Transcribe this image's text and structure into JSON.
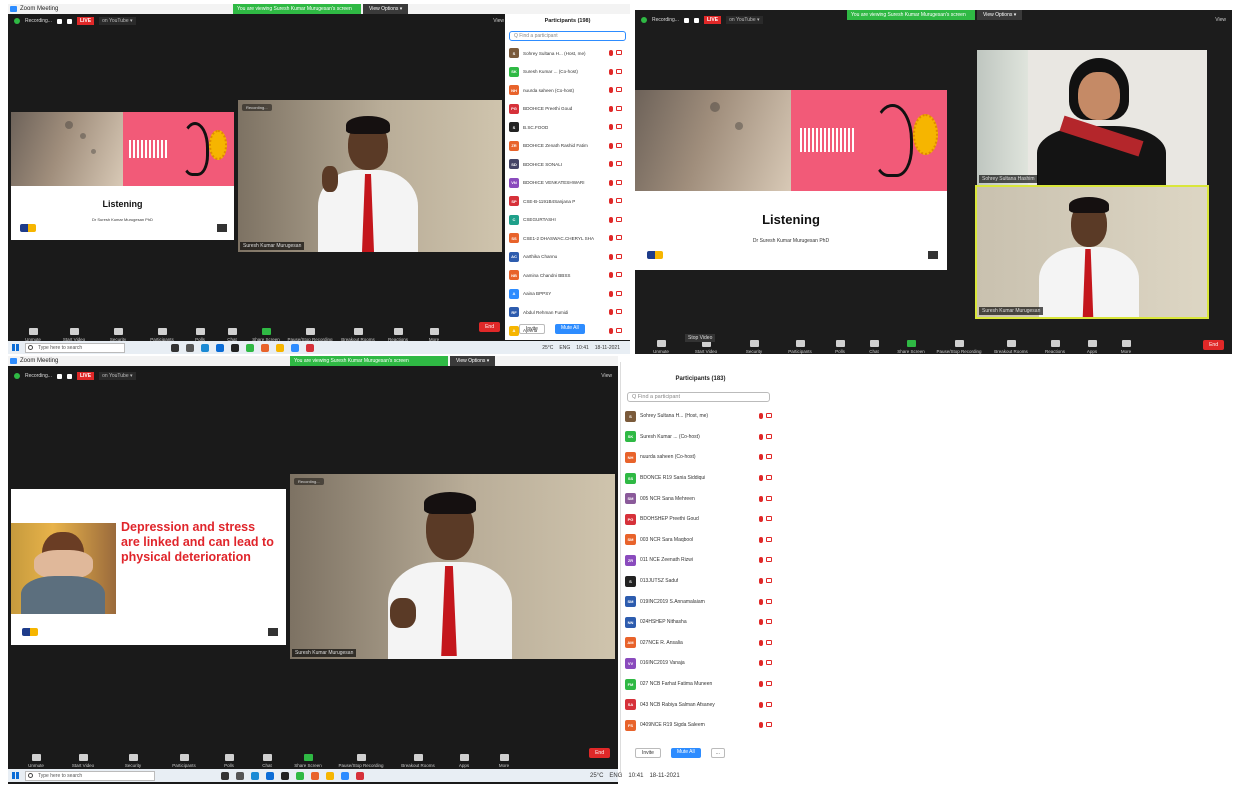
{
  "app": {
    "title": "Zoom Meeting"
  },
  "banner": {
    "sharing": "You are viewing Suresh Kumar Murugesan's screen",
    "view_options": "View Options ▾"
  },
  "topbar": {
    "recording": "Recording...",
    "live": "LIVE",
    "on_youtube": "on YouTube ▾",
    "view": "View"
  },
  "slide1": {
    "title": "Listening",
    "subtitle": "Dr Suresh Kumar Murugesan PhD"
  },
  "slide2": {
    "text": "Depression and stress are linked and can lead to physical deterioration"
  },
  "speaker": {
    "name": "Suresh Kumar Murugesan",
    "recording_badge": "Recording..."
  },
  "host_tile": {
    "name": "Sohrey Sultana Hashim"
  },
  "toolbar": {
    "items": [
      "Unmute",
      "Start Video",
      "Security",
      "Participants",
      "Polls",
      "Chat",
      "Share Screen",
      "Pause/Stop Recording",
      "Breakout Rooms",
      "Reactions",
      "Apps",
      "More"
    ],
    "participants_count": "198",
    "end": "End",
    "tooltip": "Stop Video"
  },
  "taskbar": {
    "search_placeholder": "Type here to search",
    "weather": "25°C",
    "lang": "ENG",
    "time": "10:41",
    "date": "18-11-2021"
  },
  "panel_top": {
    "header": "Participants (198)",
    "search": "Q Find a participant",
    "rows": [
      {
        "initials": "S",
        "name": "Sohrey Sultana H... (Host, me)",
        "color": "#7a5a3a"
      },
      {
        "initials": "SK",
        "name": "Suresh Kumar ... (Co-host)",
        "color": "#2fb944"
      },
      {
        "initials": "NH",
        "name": "nuurda saheen (Co-host)",
        "color": "#e8632b"
      },
      {
        "initials": "PG",
        "name": "BDOHICE Preethi Goud",
        "color": "#d6313a"
      },
      {
        "initials": "S",
        "name": "B.SC.FOOD",
        "color": "#222222"
      },
      {
        "initials": "ZR",
        "name": "BDOHICE Zenath Rashid Fatim",
        "color": "#e8632b"
      },
      {
        "initials": "SD",
        "name": "BDOHICE SONALI",
        "color": "#444466"
      },
      {
        "initials": "VN",
        "name": "BDOHICE VENKATESHWARI",
        "color": "#8a4bbd"
      },
      {
        "initials": "SP",
        "name": "CSE-B-1191B4Sanjana P",
        "color": "#d6313a"
      },
      {
        "initials": "C",
        "name": "CSEGURTASHI",
        "color": "#1fa08a"
      },
      {
        "initials": "SS",
        "name": "CSE1-2 DHASWAC.CHERYL SHA",
        "color": "#e8632b"
      },
      {
        "initials": "AC",
        "name": "Aarthika Channu",
        "color": "#2d5cae"
      },
      {
        "initials": "NB",
        "name": "Aamina Chandni BBSS",
        "color": "#e8632b"
      },
      {
        "initials": "A",
        "name": "Aaina BPPSY",
        "color": "#2d8cff"
      },
      {
        "initials": "RF",
        "name": "Abdul Rehman Fumidi",
        "color": "#2d5cae"
      },
      {
        "initials": "A",
        "name": "Ajeena",
        "color": "#f6b500"
      }
    ],
    "invite": "Invite",
    "mute_all": "Mute All"
  },
  "panel_bottom": {
    "header": "Participants (183)",
    "search": "Q Find a participant",
    "rows": [
      {
        "initials": "S",
        "name": "Sohrey Sultana H... (Host, me)",
        "color": "#7a5a3a"
      },
      {
        "initials": "SK",
        "name": "Suresh Kumar ... (Co-host)",
        "color": "#2fb944"
      },
      {
        "initials": "NH",
        "name": "nuurda saheen (Co-host)",
        "color": "#e8632b"
      },
      {
        "initials": "SS",
        "name": "BDONCE R19 Sania Siddiqui",
        "color": "#2fb944"
      },
      {
        "initials": "SM",
        "name": "005 NCR Sana Mehreen",
        "color": "#8a5a9a"
      },
      {
        "initials": "PG",
        "name": "BDOHSHEP Preethi Goud",
        "color": "#d6313a"
      },
      {
        "initials": "SM",
        "name": "003 NCR Sara Maqbool",
        "color": "#e8632b"
      },
      {
        "initials": "ZR",
        "name": "011 NCE Zeenath Rizwi",
        "color": "#8a4bbd"
      },
      {
        "initials": "S",
        "name": "013JUTSZ Saduf",
        "color": "#222222"
      },
      {
        "initials": "SM",
        "name": "019INC2019 S.Annamalaiam",
        "color": "#2d5cae"
      },
      {
        "initials": "NN",
        "name": "024HSHEP Nithasha",
        "color": "#2d5cae"
      },
      {
        "initials": "AM",
        "name": "027NCE R. Ansalia",
        "color": "#e8632b"
      },
      {
        "initials": "VV",
        "name": "016INC2019 Vanaja",
        "color": "#8a4bbd"
      },
      {
        "initials": "FM",
        "name": "027 NCB Farhat Fatima Muneen",
        "color": "#2fb944"
      },
      {
        "initials": "SA",
        "name": "043 NCB Rabiya Salman Afsaney",
        "color": "#d6313a"
      },
      {
        "initials": "FS",
        "name": "0409NCE R19 Sigda Saleem",
        "color": "#e8632b"
      }
    ],
    "invite": "Invite",
    "mute_all": "Mute All",
    "more": "..."
  },
  "colors": {
    "live_red": "#e02828",
    "zoom_blue": "#2d8cff",
    "share_green": "#2fb944",
    "slide_pink": "#f25a78",
    "slide_red_text": "#e0252b"
  },
  "icons": [
    "zoom-logo-icon",
    "shield-icon",
    "mic-icon",
    "video-icon",
    "security-icon",
    "participants-icon",
    "polls-icon",
    "chat-icon",
    "share-screen-icon",
    "record-icon",
    "breakout-icon",
    "reactions-icon",
    "apps-icon",
    "more-icon",
    "windows-icon",
    "search-icon",
    "mic-muted-icon",
    "camera-off-icon"
  ]
}
